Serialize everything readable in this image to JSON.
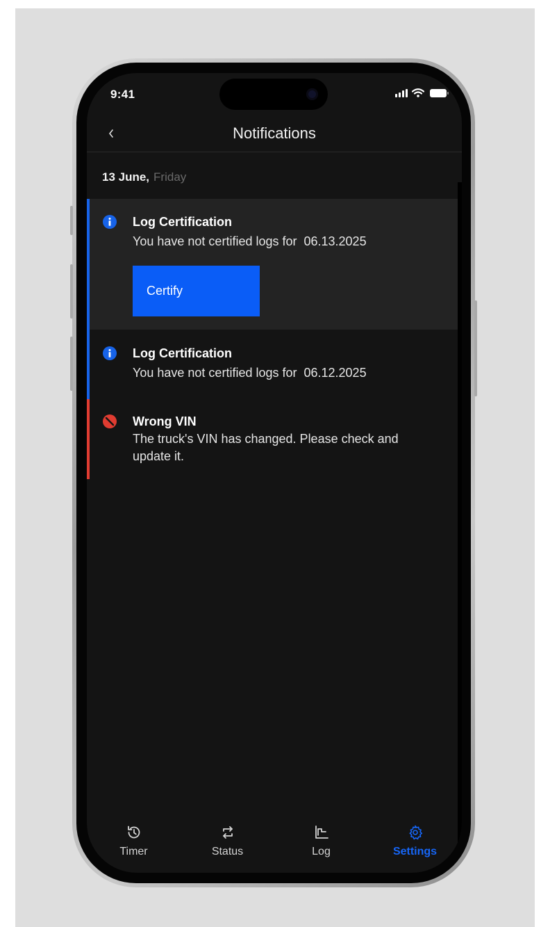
{
  "status_bar": {
    "time": "9:41"
  },
  "header": {
    "title": "Notifications",
    "back_icon": "chevron-left-icon"
  },
  "date_group": {
    "date": "13 June,",
    "weekday": "Friday"
  },
  "notifications": [
    {
      "type": "info",
      "title": "Log Certification",
      "message": "You have not certified logs for  06.13.2025",
      "action_label": "Certify",
      "highlighted": true,
      "accent": "#1763e8"
    },
    {
      "type": "info",
      "title": "Log Certification",
      "message": "You have not certified logs for  06.12.2025",
      "accent": "#1763e8"
    },
    {
      "type": "error",
      "title": "Wrong VIN",
      "message": "The truck's VIN has changed. Please check and update it.",
      "accent": "#e03c31"
    }
  ],
  "tabs": [
    {
      "label": "Timer",
      "icon": "history-icon",
      "active": false
    },
    {
      "label": "Status",
      "icon": "swap-icon",
      "active": false
    },
    {
      "label": "Log",
      "icon": "chart-icon",
      "active": false
    },
    {
      "label": "Settings",
      "icon": "gear-icon",
      "active": true
    }
  ],
  "colors": {
    "accent": "#1666f7",
    "info": "#1763e8",
    "error": "#e03c31",
    "background": "#141414",
    "highlight_row": "#232323"
  }
}
